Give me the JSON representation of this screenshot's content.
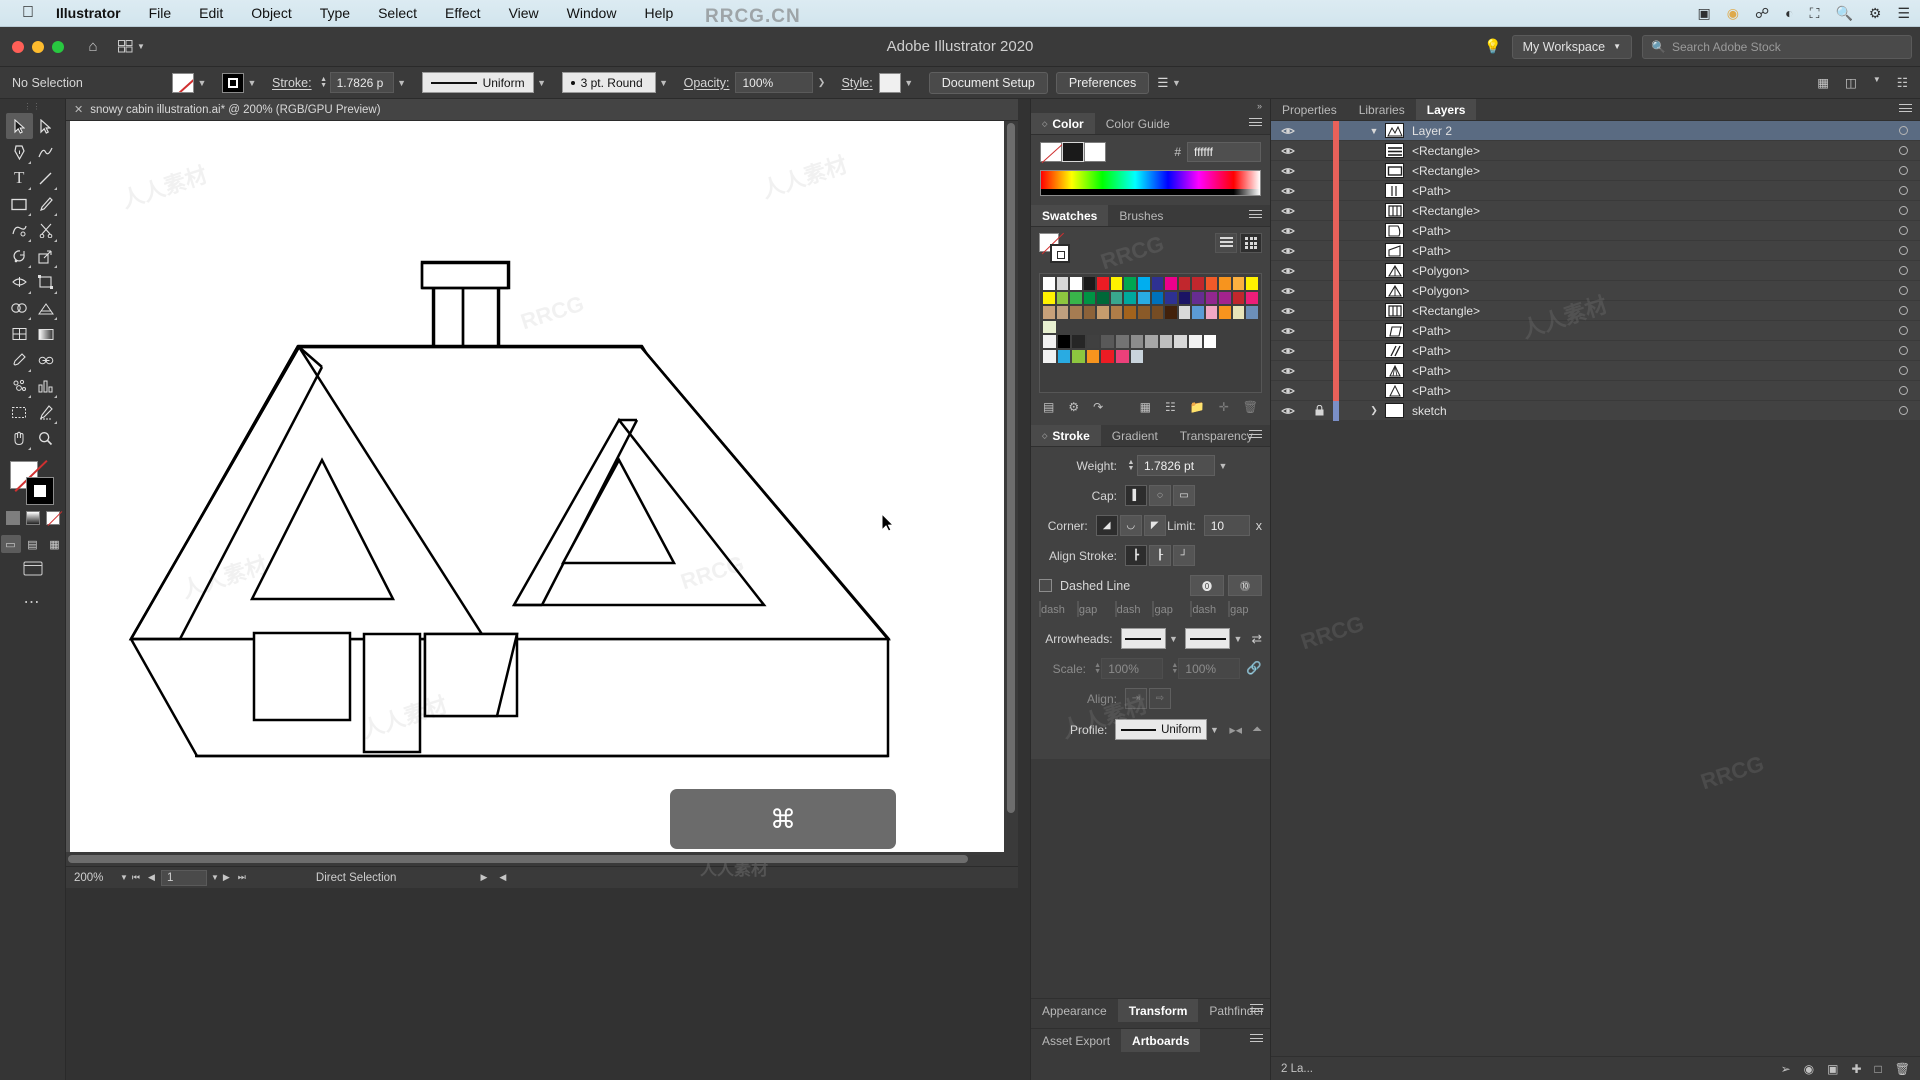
{
  "macbar": {
    "apple_icon": "apple-icon",
    "items": [
      "Illustrator",
      "File",
      "Edit",
      "Object",
      "Type",
      "Select",
      "Effect",
      "View",
      "Window",
      "Help"
    ],
    "right_icons": [
      "screen-record-icon",
      "camera-icon",
      "bluetooth-icon",
      "wifi-icon",
      "display-icon",
      "search-icon",
      "control-center-icon",
      "menu-icon"
    ]
  },
  "titlebar": {
    "home_icon": "home-icon",
    "arrange_icon": "arrange-documents-icon",
    "document_title": "Adobe Illustrator 2020",
    "bulb_icon": "lightbulb-icon",
    "workspace": "My Workspace",
    "search_placeholder": "Search Adobe Stock",
    "search_icon": "search-icon"
  },
  "controlbar": {
    "selection_status": "No Selection",
    "fill_swatch": "none-fill-swatch",
    "stroke_swatch": "black-stroke-swatch",
    "stroke_label": "Stroke:",
    "stroke_weight": "1.7826 p",
    "variable_width_profile": "Uniform",
    "brush_definition": "3 pt. Round",
    "opacity_label": "Opacity:",
    "opacity_value": "100%",
    "style_label": "Style:",
    "document_setup": "Document Setup",
    "preferences": "Preferences",
    "align_icon": "align-icon"
  },
  "toolbar": {
    "tools": [
      {
        "name": "selection-tool",
        "glyph": "↖"
      },
      {
        "name": "direct-selection-tool",
        "glyph": "↗"
      },
      {
        "name": "pen-tool",
        "glyph": "✒"
      },
      {
        "name": "curvature-tool",
        "glyph": "∿"
      },
      {
        "name": "type-tool",
        "glyph": "T"
      },
      {
        "name": "line-segment-tool",
        "glyph": "╱"
      },
      {
        "name": "rectangle-tool",
        "glyph": "▭"
      },
      {
        "name": "paintbrush-tool",
        "glyph": "✎"
      },
      {
        "name": "shaper-tool",
        "glyph": "◠"
      },
      {
        "name": "scissors-tool",
        "glyph": "✂"
      },
      {
        "name": "rotate-tool",
        "glyph": "↻"
      },
      {
        "name": "scale-tool",
        "glyph": "⇲"
      },
      {
        "name": "width-tool",
        "glyph": "⦿"
      },
      {
        "name": "free-transform-tool",
        "glyph": "⬚"
      },
      {
        "name": "shape-builder-tool",
        "glyph": "◑"
      },
      {
        "name": "perspective-grid-tool",
        "glyph": "▦"
      },
      {
        "name": "mesh-tool",
        "glyph": "⌗"
      },
      {
        "name": "gradient-tool",
        "glyph": "◫"
      },
      {
        "name": "eyedropper-tool",
        "glyph": "⚗"
      },
      {
        "name": "blend-tool",
        "glyph": "∞"
      },
      {
        "name": "symbol-sprayer-tool",
        "glyph": "❂"
      },
      {
        "name": "column-graph-tool",
        "glyph": "█"
      },
      {
        "name": "artboard-tool",
        "glyph": "⬜"
      },
      {
        "name": "slice-tool",
        "glyph": "✄"
      },
      {
        "name": "hand-tool",
        "glyph": "✋"
      },
      {
        "name": "zoom-tool",
        "glyph": "⚲"
      }
    ],
    "fill_label": "fill-swatch",
    "stroke_label": "stroke-swatch",
    "draw_modes": [
      "draw-normal",
      "draw-behind",
      "draw-inside"
    ],
    "screen_mode": "change-screen-mode",
    "more_tools": "edit-toolbar-icon"
  },
  "document": {
    "tab_title": "snowy cabin illustration.ai* @ 200% (RGB/GPU Preview)",
    "close_icon": "close-tab-icon"
  },
  "statusbar": {
    "zoom": "200%",
    "page": "1",
    "tool": "Direct Selection",
    "first_icon": "first-page-icon",
    "prev_icon": "previous-page-icon",
    "next_icon": "next-page-icon",
    "last_icon": "last-page-icon"
  },
  "overlay": {
    "key_hint": "⌘"
  },
  "color_panel": {
    "tabs": [
      "Color",
      "Color Guide"
    ],
    "active_tab": "Color",
    "hash": "#",
    "hex_value": "ffffff",
    "menu_icon": "panel-menu-icon"
  },
  "swatches_panel": {
    "tabs": [
      "Swatches",
      "Brushes"
    ],
    "active_tab": "Swatches",
    "menu_icon": "panel-menu-icon",
    "view_list_icon": "list-view-icon",
    "view_grid_icon": "grid-view-icon",
    "rows": [
      [
        "#ffffff",
        "#d8d8d8",
        "#ffffff",
        "#1a1a1a",
        "#ed1c24",
        "#fff200",
        "#00a651",
        "#00aeef",
        "#2e3192",
        "#ec008c",
        "#c1272d",
        "#c1272d",
        "#f15a29",
        "#f7941e",
        "#fbb040",
        "#fff200"
      ],
      [
        "#fff200",
        "#8dc63f",
        "#39b54a",
        "#009444",
        "#006838",
        "#39a78e",
        "#00a99d",
        "#29abe2",
        "#0071bc",
        "#2e3192",
        "#1b1464",
        "#662d91",
        "#92278f",
        "#a3238e",
        "#c1272d",
        "#ed1e79"
      ],
      [
        "#c7a17a",
        "#bfa07f",
        "#a67c52",
        "#8c6239",
        "#c69c6d",
        "#b07d48",
        "#a3631c",
        "#8a5a28",
        "#754c24",
        "#42210b",
        "#d9d9d9",
        "#5b9bd5",
        "#f2a7c3",
        "#f7941e",
        "#e8e4b8",
        "#6c8fb8"
      ],
      [
        "#e8f0d0"
      ],
      [
        "#f2f2f2",
        "#000000",
        "#262626",
        "#404040",
        "#595959",
        "#737373",
        "#8c8c8c",
        "#a6a6a6",
        "#bfbfbf",
        "#d9d9d9",
        "#f2f2f2",
        "#ffffff"
      ],
      [
        "#f2f2f2",
        "#29abe2",
        "#8dc63f",
        "#f7941e",
        "#ed1c24",
        "#ec407a",
        "#c9d4dc"
      ]
    ],
    "footer_icons": [
      "swatch-libraries-icon",
      "show-swatch-kinds-icon",
      "libraries-icon",
      "swatch-options-icon",
      "new-color-group-icon",
      "new-swatch-icon",
      "delete-swatch-icon"
    ]
  },
  "stroke_panel": {
    "tabs": [
      "Stroke",
      "Gradient",
      "Transparency"
    ],
    "active_tab": "Stroke",
    "menu_icon": "panel-menu-icon",
    "weight_label": "Weight:",
    "weight_value": "1.7826 pt",
    "cap_label": "Cap:",
    "corner_label": "Corner:",
    "limit_label": "Limit:",
    "limit_value": "10",
    "limit_unit": "x",
    "align_stroke_label": "Align Stroke:",
    "dashed_line_label": "Dashed Line",
    "dash_labels": [
      "dash",
      "gap",
      "dash",
      "gap",
      "dash",
      "gap"
    ],
    "arrowheads_label": "Arrowheads:",
    "scale_label": "Scale:",
    "scale_values": [
      "100%",
      "100%"
    ],
    "align_label": "Align:",
    "profile_label": "Profile:",
    "profile_value": "Uniform"
  },
  "bottom_tabs_a": {
    "tabs": [
      "Appearance",
      "Transform",
      "Pathfinder"
    ],
    "active_tab": "Transform",
    "menu_icon": "panel-menu-icon"
  },
  "bottom_tabs_b": {
    "tabs": [
      "Asset Export",
      "Artboards"
    ],
    "active_tab": "Artboards",
    "menu_icon": "panel-menu-icon"
  },
  "layers_panel": {
    "tabs": [
      "Properties",
      "Libraries",
      "Layers"
    ],
    "active_tab": "Layers",
    "menu_icon": "panel-menu-icon",
    "rows": [
      {
        "name": "Layer 2",
        "type": "layer",
        "selected": true,
        "locked": false,
        "expanded": true,
        "thumb": "mountain-thumb",
        "color": "#e8615a"
      },
      {
        "name": "<Rectangle>",
        "type": "object",
        "thumb": "rectangle-lines-thumb"
      },
      {
        "name": "<Rectangle>",
        "type": "object",
        "thumb": "rectangle-thumb"
      },
      {
        "name": "<Path>",
        "type": "object",
        "thumb": "path-vertical-thumb"
      },
      {
        "name": "<Rectangle>",
        "type": "object",
        "thumb": "rectangle-columns-thumb"
      },
      {
        "name": "<Path>",
        "type": "object",
        "thumb": "path-curve-thumb"
      },
      {
        "name": "<Path>",
        "type": "object",
        "thumb": "path-diagonal-thumb"
      },
      {
        "name": "<Polygon>",
        "type": "object",
        "thumb": "polygon-triangle-thumb"
      },
      {
        "name": "<Polygon>",
        "type": "object",
        "thumb": "polygon-triangle-thumb"
      },
      {
        "name": "<Rectangle>",
        "type": "object",
        "thumb": "rectangle-columns-thumb"
      },
      {
        "name": "<Path>",
        "type": "object",
        "thumb": "path-quad-thumb"
      },
      {
        "name": "<Path>",
        "type": "object",
        "thumb": "path-slash-thumb"
      },
      {
        "name": "<Path>",
        "type": "object",
        "thumb": "path-triangle-thumb"
      },
      {
        "name": "<Path>",
        "type": "object",
        "thumb": "path-thumb"
      },
      {
        "name": "sketch",
        "type": "layer",
        "locked": true,
        "thumb": "blank-thumb",
        "color": "#7a8fc7"
      }
    ],
    "footer_count": "2 La...",
    "footer_icons": [
      "locate-object-icon",
      "make-clipping-mask-icon",
      "create-sublayer-icon",
      "create-layer-icon",
      "delete-layer-icon"
    ]
  },
  "watermark": {
    "brand": "RRCG.CN",
    "footer": "人人素材",
    "tiles": [
      "人人素材",
      "RRCG"
    ]
  }
}
